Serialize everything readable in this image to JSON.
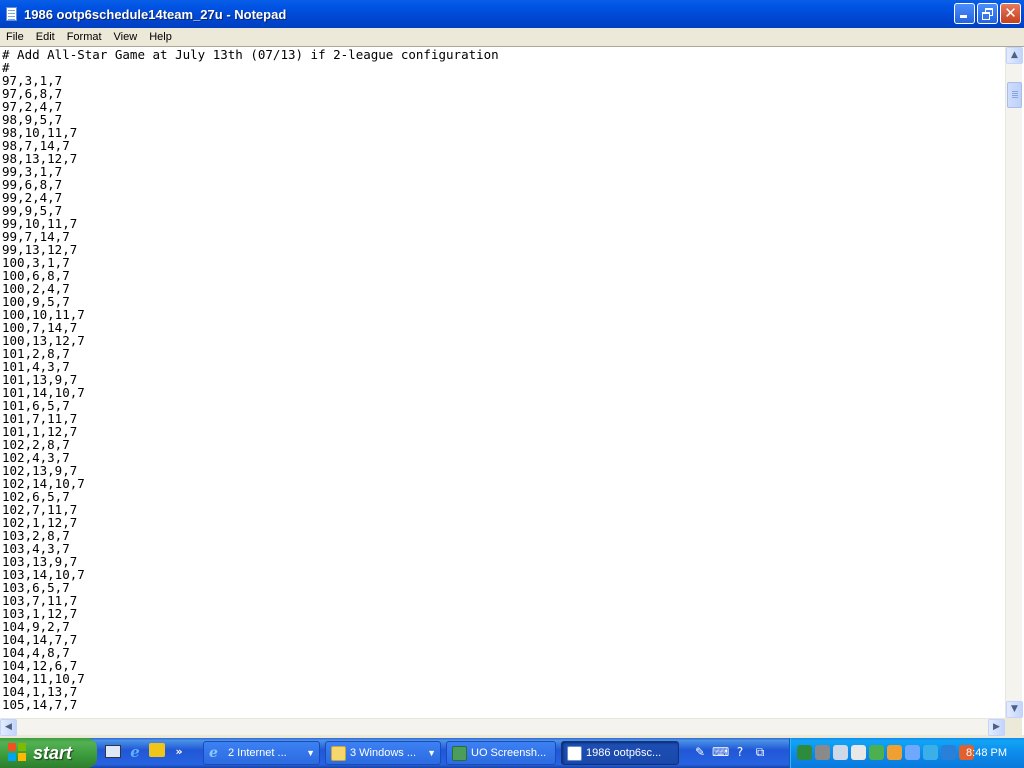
{
  "window": {
    "title": "1986 ootp6schedule14team_27u - Notepad",
    "icon": "notepad-icon"
  },
  "menu": [
    {
      "label": "File"
    },
    {
      "label": "Edit"
    },
    {
      "label": "Format"
    },
    {
      "label": "View"
    },
    {
      "label": "Help"
    }
  ],
  "editor": {
    "lines": [
      "# Add All-Star Game at July 13th (07/13) if 2-league configuration",
      "#",
      "97,3,1,7",
      "97,6,8,7",
      "97,2,4,7",
      "98,9,5,7",
      "98,10,11,7",
      "98,7,14,7",
      "98,13,12,7",
      "99,3,1,7",
      "99,6,8,7",
      "99,2,4,7",
      "99,9,5,7",
      "99,10,11,7",
      "99,7,14,7",
      "99,13,12,7",
      "100,3,1,7",
      "100,6,8,7",
      "100,2,4,7",
      "100,9,5,7",
      "100,10,11,7",
      "100,7,14,7",
      "100,13,12,7",
      "101,2,8,7",
      "101,4,3,7",
      "101,13,9,7",
      "101,14,10,7",
      "101,6,5,7",
      "101,7,11,7",
      "101,1,12,7",
      "102,2,8,7",
      "102,4,3,7",
      "102,13,9,7",
      "102,14,10,7",
      "102,6,5,7",
      "102,7,11,7",
      "102,1,12,7",
      "103,2,8,7",
      "103,4,3,7",
      "103,13,9,7",
      "103,14,10,7",
      "103,6,5,7",
      "103,7,11,7",
      "103,1,12,7",
      "104,9,2,7",
      "104,14,7,7",
      "104,4,8,7",
      "104,12,6,7",
      "104,11,10,7",
      "104,1,13,7",
      "105,14,7,7"
    ]
  },
  "taskbar": {
    "start_label": "start",
    "quick_launch_chevron": "»",
    "tasks": [
      {
        "label": "2 Internet ...",
        "icon": "internet-explorer-icon",
        "grouped": true
      },
      {
        "label": "3 Windows ...",
        "icon": "folder-icon",
        "grouped": true
      },
      {
        "label": "UO Screensh...",
        "icon": "application-icon",
        "grouped": false
      },
      {
        "label": "1986 ootp6sc...",
        "icon": "notepad-icon",
        "grouped": false,
        "active": true
      }
    ],
    "clock": "8:48 PM"
  },
  "colors": {
    "titlebar": "#0055E5",
    "taskbar": "#2157D7",
    "start": "#3A9A3A",
    "tray": "#0C8BEB",
    "editor_bg": "#FFFFFF"
  }
}
